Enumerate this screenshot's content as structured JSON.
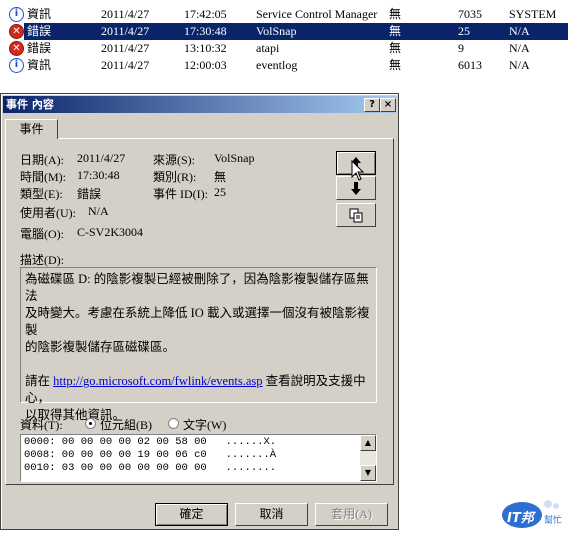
{
  "event_list": {
    "rows": [
      {
        "type": "資訊",
        "icon": "info-icon",
        "date": "2011/4/27",
        "time": "17:42:05",
        "source": "Service Control Manager",
        "category": "無",
        "event": "7035",
        "user": "SYSTEM",
        "selected": false
      },
      {
        "type": "錯誤",
        "icon": "error-icon",
        "date": "2011/4/27",
        "time": "17:30:48",
        "source": "VolSnap",
        "category": "無",
        "event": "25",
        "user": "N/A",
        "selected": true
      },
      {
        "type": "錯誤",
        "icon": "error-icon",
        "date": "2011/4/27",
        "time": "13:10:32",
        "source": "atapi",
        "category": "無",
        "event": "9",
        "user": "N/A",
        "selected": false
      },
      {
        "type": "資訊",
        "icon": "info-icon",
        "date": "2011/4/27",
        "time": "12:00:03",
        "source": "eventlog",
        "category": "無",
        "event": "6013",
        "user": "N/A",
        "selected": false
      }
    ]
  },
  "dialog": {
    "title": "事件 內容",
    "help_glyph": "?",
    "close_glyph": "×",
    "tab_label": "事件",
    "fields": {
      "date_label": "日期(A):",
      "date_value": "2011/4/27",
      "source_label": "來源(S):",
      "source_value": "VolSnap",
      "time_label": "時間(M):",
      "time_value": "17:30:48",
      "category_label": "類別(R):",
      "category_value": "無",
      "type_label": "類型(E):",
      "type_value": "錯誤",
      "eventid_label": "事件 ID(I):",
      "eventid_value": "25",
      "user_label": "使用者(U):",
      "user_value": "N/A",
      "computer_label": "電腦(O):",
      "computer_value": "C-SV2K3004"
    },
    "description_label": "描述(D):",
    "description": {
      "line1": "為磁碟區 D: 的陰影複製已經被刪除了，因為陰影複製儲存區無法",
      "line2": "及時變大。考慮在系統上降低 IO 載入或選擇一個沒有被陰影複製",
      "line3": "的陰影複製儲存區磁碟區。",
      "help_prefix": "請在 ",
      "help_link": "http://go.microsoft.com/fwlink/events.asp",
      "help_suffix": " 查看說明及支援中心，",
      "help_line2": "以取得其他資訊。"
    },
    "data_label": "資料(T):",
    "radio_bytes": "位元組(B)",
    "radio_words": "文字(W)",
    "data_lines": [
      "0000: 00 00 00 00 02 00 58 00   ......X.",
      "0008: 00 00 00 00 19 00 06 c0   .......À",
      "0010: 03 00 00 00 00 00 00 00   ........"
    ],
    "buttons": {
      "ok": "確定",
      "cancel": "取消",
      "apply": "套用(A)"
    }
  },
  "watermark": {
    "brand": "IT邦",
    "sub": "幫忙"
  }
}
